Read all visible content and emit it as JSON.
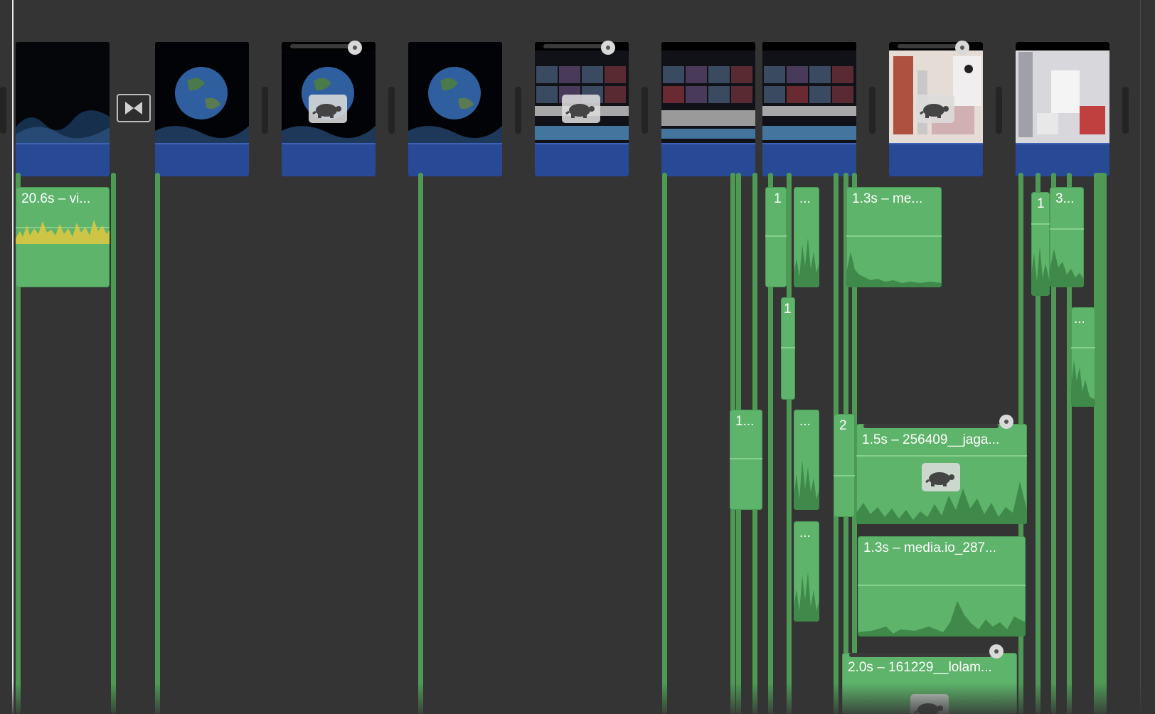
{
  "timeline": {
    "title": "",
    "transition_icon": "cross-dissolve-icon",
    "speed_icon": "turtle-slow-motion-icon",
    "retime_handle_icon": "retime-knob-icon"
  },
  "video_clips": [
    {
      "id": "v1",
      "content": "earth-dust"
    },
    {
      "id": "v2",
      "content": "earth"
    },
    {
      "id": "v3",
      "content": "earth",
      "slow_motion": true
    },
    {
      "id": "v4",
      "content": "earth"
    },
    {
      "id": "v5",
      "content": "control-panel",
      "slow_motion": true
    },
    {
      "id": "v6",
      "content": "control-panel"
    },
    {
      "id": "v7",
      "content": "control-panel"
    },
    {
      "id": "v8",
      "content": "robot-room",
      "slow_motion": true
    },
    {
      "id": "v9",
      "content": "robot-room"
    }
  ],
  "audio_clips": {
    "a1": {
      "label": "20.6s – vi..."
    },
    "a2": {
      "label": "1"
    },
    "a3": {
      "label": "..."
    },
    "a4": {
      "label": "1.3s – me..."
    },
    "a5": {
      "label": "1"
    },
    "a6": {
      "label": "3..."
    },
    "a7": {
      "label": "1"
    },
    "a8": {
      "label": "..."
    },
    "a9": {
      "label": "1..."
    },
    "a10": {
      "label": "..."
    },
    "a11": {
      "label": "2"
    },
    "a12": {
      "label": "1.5s – 256409__jaga..."
    },
    "a13": {
      "label": "..."
    },
    "a14": {
      "label": "1.3s – media.io_287..."
    },
    "a15": {
      "label": "2.0s – 161229__lolam..."
    }
  },
  "colors": {
    "background": "#343434",
    "video_audio_band": "#284a96",
    "audio_clip": "#5db46a",
    "connection_line": "#4e9a55",
    "playhead": "#e8e8e8",
    "peak": "#e0c840"
  }
}
